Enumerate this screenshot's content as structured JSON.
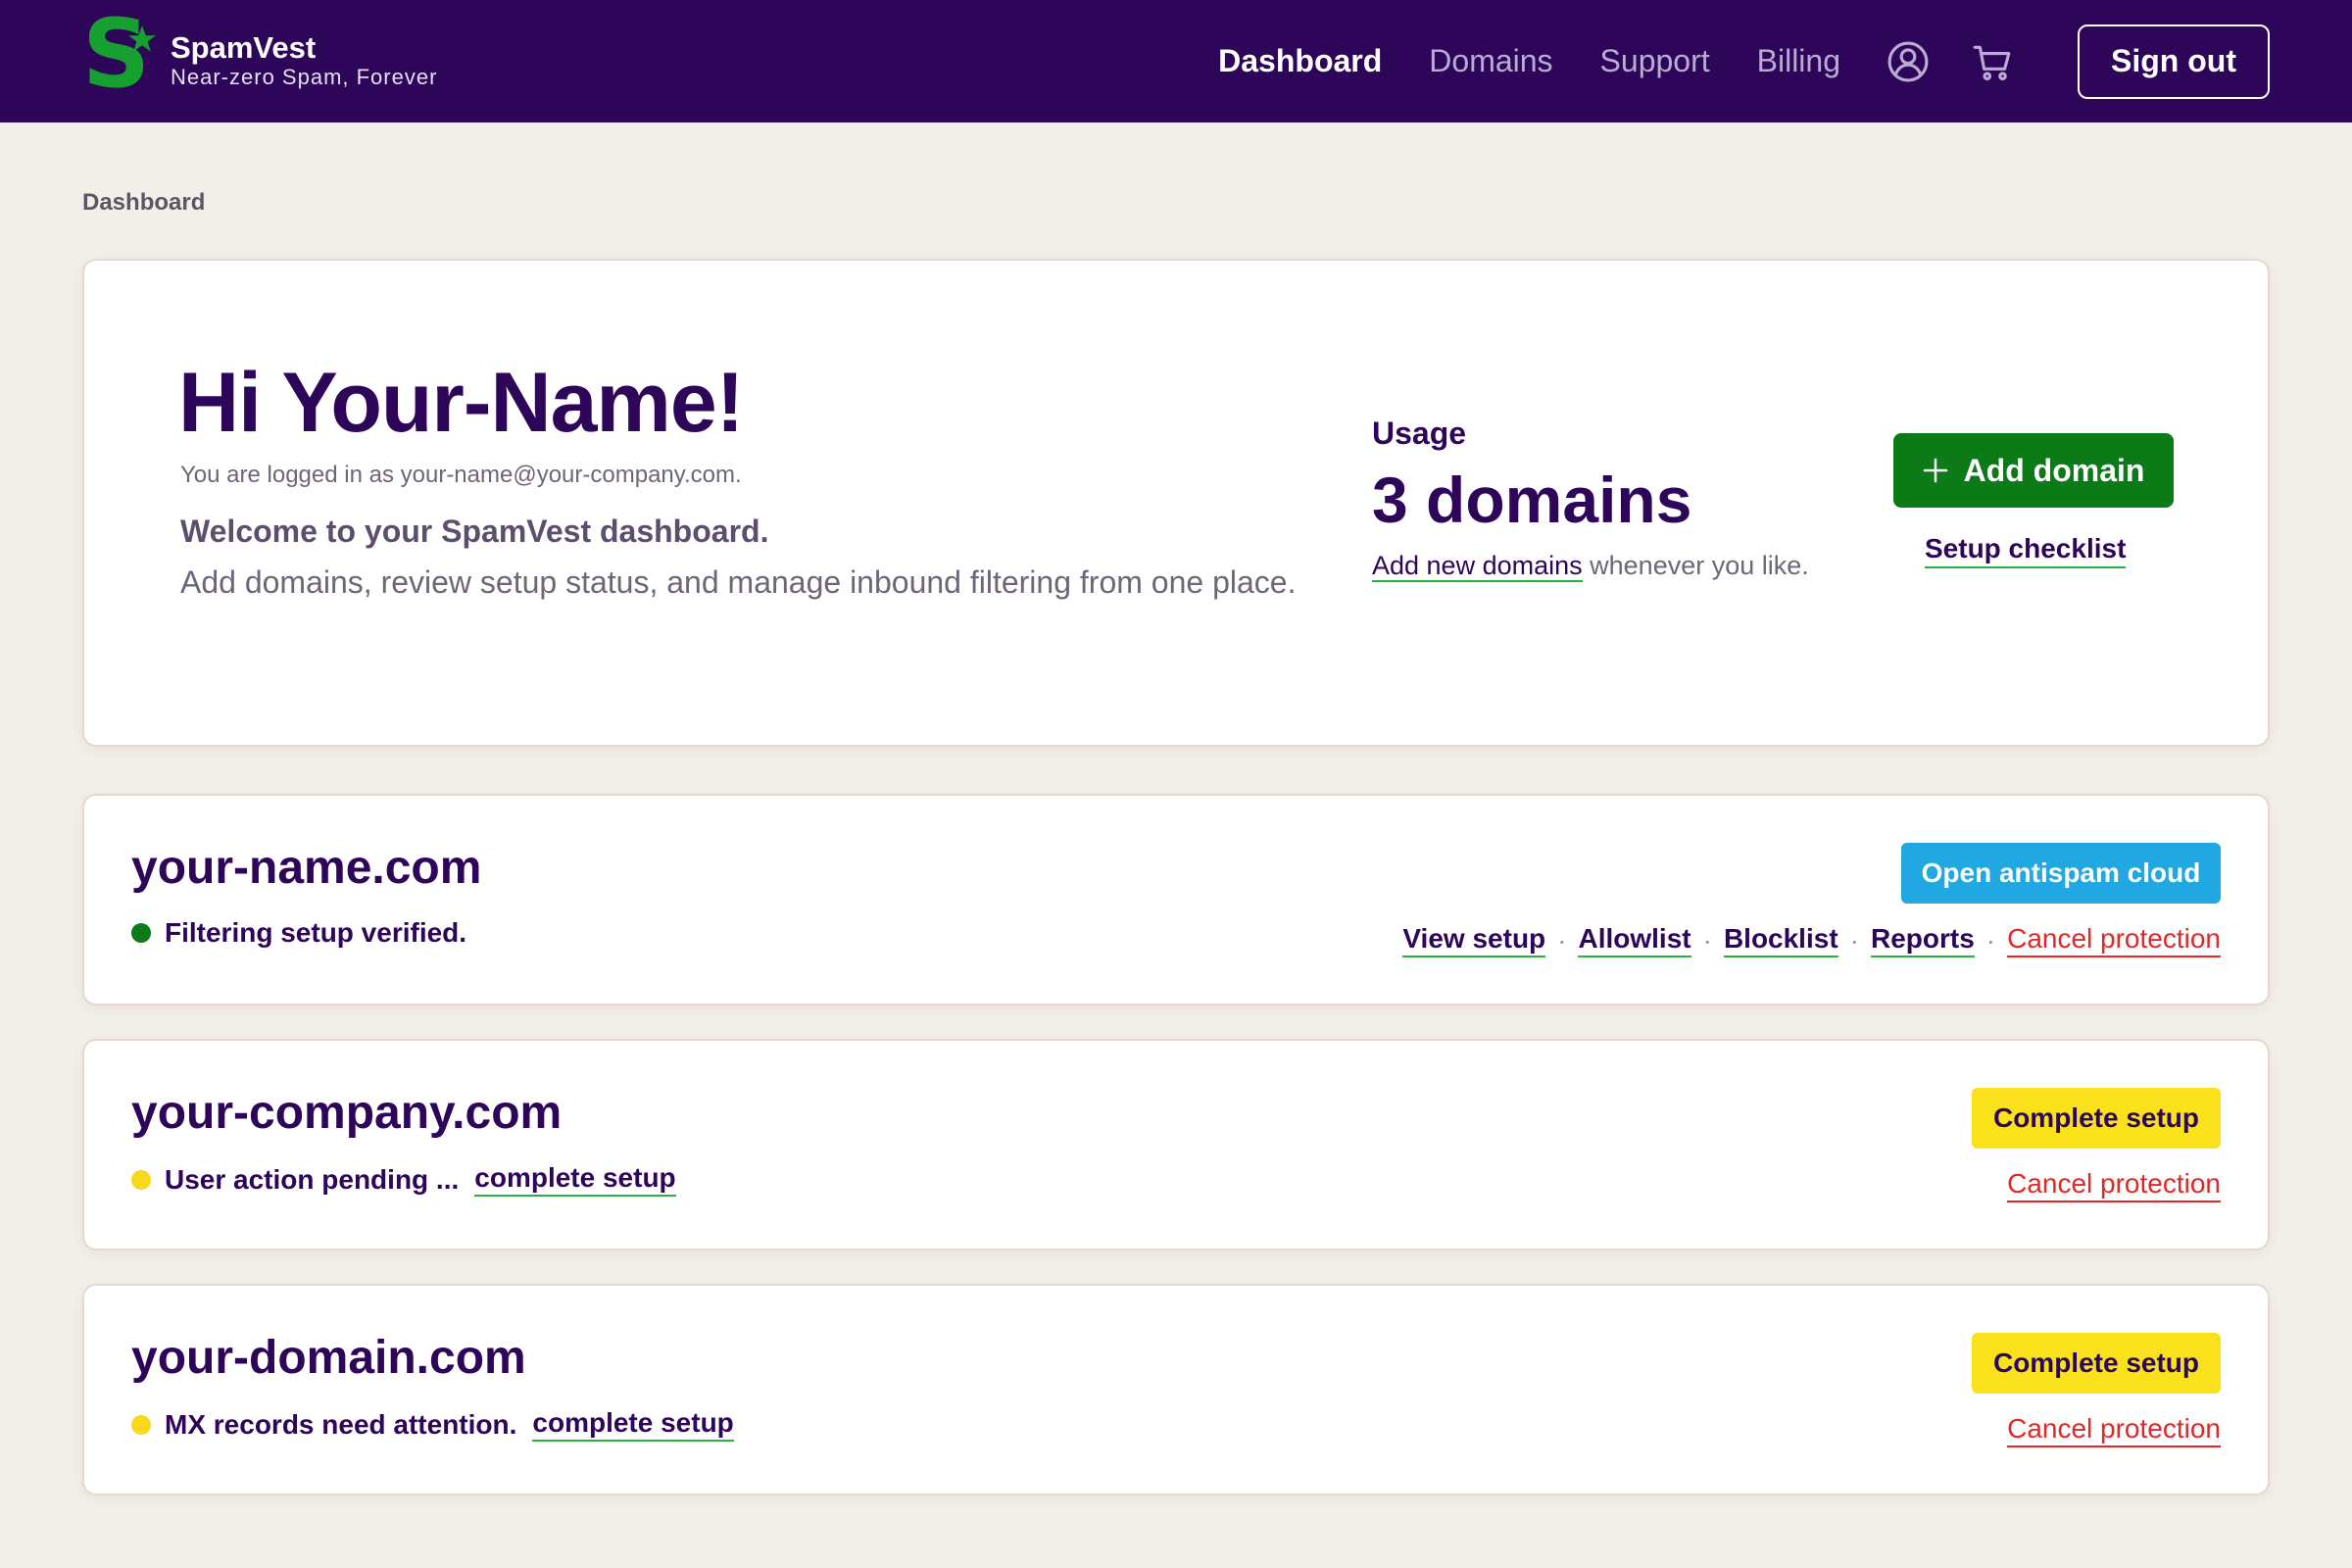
{
  "header": {
    "brand_mark": "S",
    "brand_name": "SpamVest",
    "tagline": "Near-zero Spam, Forever",
    "nav": {
      "dashboard": "Dashboard",
      "domains": "Domains",
      "support": "Support",
      "billing": "Billing"
    },
    "icons": [
      "account-icon",
      "cart-icon"
    ],
    "sign_out": "Sign out"
  },
  "breadcrumb": "Dashboard",
  "welcome": {
    "greeting": "Hi Your-Name!",
    "logged_in_as": "You are logged in as your-name@your-company.com.",
    "heading": "Welcome to your SpamVest dashboard.",
    "description": "Add domains, review setup status, and manage inbound filtering from one place."
  },
  "usage": {
    "label": "Usage",
    "value": "3 domains",
    "note_link": "Add new domains",
    "note_rest": " whenever you like."
  },
  "actions": {
    "add_domain": "Add domain",
    "setup_checklist": "Setup checklist"
  },
  "domains": [
    {
      "name": "your-name.com",
      "status": "Filtering setup verified.",
      "status_color": "#0b7a17",
      "button": "Open antispam cloud",
      "links": {
        "view_setup": "View setup",
        "allowlist": "Allowlist",
        "blocklist": "Blocklist",
        "reports": "Reports",
        "cancel": "Cancel protection"
      },
      "separator": "·"
    },
    {
      "name": "your-company.com",
      "status": "User action pending ...",
      "status_color": "#f7d81b",
      "status_link": "complete setup",
      "button": "Complete setup",
      "cancel": "Cancel protection"
    },
    {
      "name": "your-domain.com",
      "status": "MX records need attention.",
      "status_color": "#f7d81b",
      "status_link": "complete setup",
      "button": "Complete setup",
      "cancel": "Cancel protection"
    }
  ],
  "colors": {
    "header_bg": "#2e0659",
    "brand_green": "#16a02f",
    "primary_button": "#0b7a17",
    "cloud_button": "#21a7e1",
    "pending_button": "#f9e11b",
    "danger": "#e32626",
    "page_bg": "#f2efe9"
  }
}
